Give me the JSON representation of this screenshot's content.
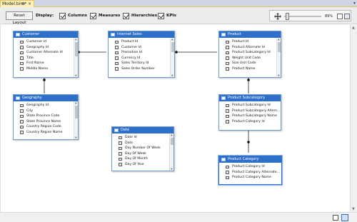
{
  "tab": {
    "title": "Model.bim*",
    "pin": "⊕",
    "close": "×",
    "dropdown": "▾"
  },
  "toolbar": {
    "reset_label": "Reset Layout",
    "display_label": "Display:",
    "checkboxes": [
      {
        "label": "Columns",
        "checked": true
      },
      {
        "label": "Measures",
        "checked": true
      },
      {
        "label": "Hierarchies",
        "checked": true
      },
      {
        "label": "KPIs",
        "checked": true
      }
    ],
    "zoom": {
      "value_text": "89%",
      "level_percent": 89
    }
  },
  "tables": {
    "customer": {
      "name": "Customer",
      "columns": [
        "Customer Id",
        "Geography Id",
        "Customer Alternate Id",
        "Title",
        "First Name",
        "Middle Name"
      ]
    },
    "internet_sales": {
      "name": "Internet Sales",
      "columns": [
        "Product Id",
        "Customer Id",
        "Promotion Id",
        "Currency Id",
        "Sales Territory Id",
        "Sales Order Number"
      ]
    },
    "product": {
      "name": "Product",
      "columns": [
        "Product Id",
        "Product Alternate Id",
        "Product Subcategory Id",
        "Weight Unit Code",
        "Size Unit Code",
        "Product Name"
      ]
    },
    "geography": {
      "name": "Geography",
      "columns": [
        "Geography Id",
        "City",
        "State Province Code",
        "State Province Name",
        "Country Region Code",
        "Country Region Name"
      ]
    },
    "date": {
      "name": "Date",
      "columns": [
        "Date Id",
        "Date",
        "Day Number Of Week",
        "Day Of Week",
        "Day Of Month",
        "Day Of Year"
      ]
    },
    "product_subcategory": {
      "name": "Product Subcategory",
      "columns": [
        "Product Subcategory Id",
        "Product Subcategory Altern...",
        "Product Subcategory Name",
        "Product Category Id"
      ]
    },
    "product_category": {
      "name": "Product Category",
      "columns": [
        "Product Category Id",
        "Product Category Alternate...",
        "Product Category Name"
      ]
    }
  }
}
